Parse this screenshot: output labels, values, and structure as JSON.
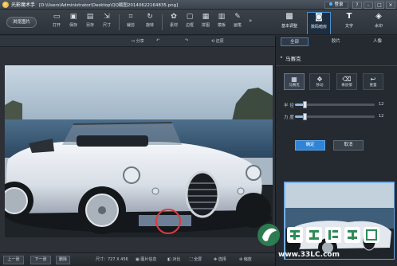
{
  "window": {
    "app_name": "光影魔术手",
    "file_path": "[D:\\Users\\Administrator\\Desktop\\QQ截图20140622164835.png]",
    "login": "登录",
    "controls": [
      "?",
      "-",
      "□",
      "×"
    ]
  },
  "toolbar": {
    "browse": "浏览图片",
    "tools": [
      {
        "label": "打开",
        "icon": "open-icon"
      },
      {
        "label": "保存",
        "icon": "save-icon"
      },
      {
        "label": "另存",
        "icon": "save-as-icon"
      },
      {
        "label": "尺寸",
        "icon": "resize-icon"
      },
      {
        "label": "裁剪",
        "icon": "crop-icon"
      },
      {
        "label": "旋转",
        "icon": "rotate-icon"
      },
      {
        "label": "素材",
        "icon": "material-icon"
      },
      {
        "label": "边框",
        "icon": "border-icon"
      },
      {
        "label": "拼图",
        "icon": "collage-icon"
      },
      {
        "label": "模板",
        "icon": "template-icon"
      },
      {
        "label": "画笔",
        "icon": "brush-icon"
      }
    ],
    "right_tabs": [
      {
        "label": "基本调整",
        "icon": "adjust-icon"
      },
      {
        "label": "数码暗房",
        "icon": "darkroom-icon"
      },
      {
        "label": "文字",
        "icon": "text-icon"
      },
      {
        "label": "水印",
        "icon": "watermark-icon"
      }
    ]
  },
  "subbar": {
    "share": "分享",
    "undo": "",
    "redo": "",
    "reset": "还原"
  },
  "panel": {
    "tabs": [
      "全部",
      "胶片",
      "人像"
    ],
    "section_title": "马赛克",
    "modes": [
      {
        "label": "马赛克",
        "icon": "mosaic-icon"
      },
      {
        "label": "移动",
        "icon": "move-icon"
      },
      {
        "label": "橡皮擦",
        "icon": "eraser-icon"
      },
      {
        "label": "重置",
        "icon": "undo-icon"
      }
    ],
    "sliders": [
      {
        "label": "半 径",
        "value": "12",
        "fraction": 0.12
      },
      {
        "label": "力 度",
        "value": "12",
        "fraction": 0.12
      }
    ],
    "confirm": "确定",
    "cancel": "取消"
  },
  "statusbar": {
    "prev": "上一张",
    "next": "下一张",
    "delete": "删除",
    "size": "尺寸：727 X 456",
    "info": "图片信息",
    "compare": "对比",
    "fullscreen": "全屏",
    "select": "选择",
    "zoom": "缩放"
  },
  "watermark": {
    "logo_text": "绿茶软件园",
    "url": "www.33LC.com"
  },
  "colors": {
    "accent": "#2f84d7",
    "panel_bg": "#252a30",
    "workspace_bg": "#2d3137"
  }
}
